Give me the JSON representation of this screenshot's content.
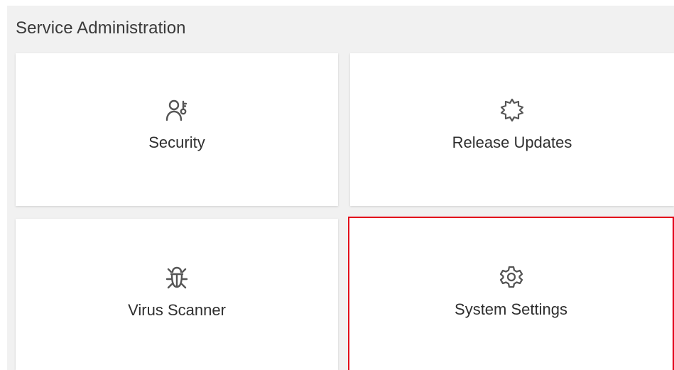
{
  "section": {
    "title": "Service Administration"
  },
  "tiles": [
    {
      "label": "Security",
      "icon": "user-key-icon"
    },
    {
      "label": "Release Updates",
      "icon": "badge-gear-icon"
    },
    {
      "label": "Virus Scanner",
      "icon": "bug-icon"
    },
    {
      "label": "System Settings",
      "icon": "gear-icon",
      "selected": true
    }
  ],
  "colors": {
    "panel_background": "#f1f1f1",
    "tile_background": "#ffffff",
    "selection_border": "#e2001a",
    "text": "#2f2f2f"
  }
}
